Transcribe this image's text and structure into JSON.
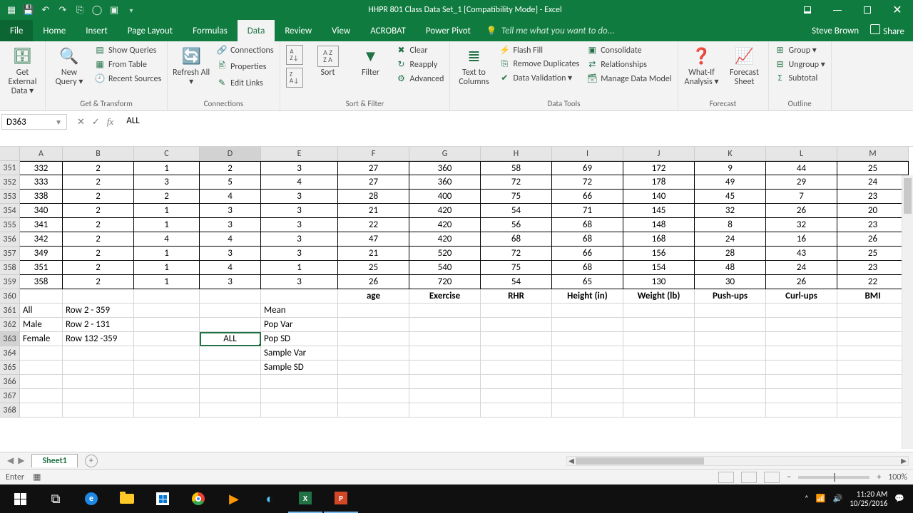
{
  "title": "HHPR 801 Class Data Set_1  [Compatibility Mode] - Excel",
  "user": "Steve Brown",
  "share": "Share",
  "tabs": {
    "file": "File",
    "home": "Home",
    "insert": "Insert",
    "pagelayout": "Page Layout",
    "formulas": "Formulas",
    "data": "Data",
    "review": "Review",
    "view": "View",
    "acrobat": "ACROBAT",
    "powerpivot": "Power Pivot",
    "tellme": "Tell me what you want to do..."
  },
  "ribbon": {
    "getdata": {
      "label": "Get External Data",
      "btn": "Get External Data ▾"
    },
    "gettransform": {
      "label": "Get & Transform",
      "newquery": "New Query ▾",
      "showqueries": "Show Queries",
      "fromtable": "From Table",
      "recent": "Recent Sources"
    },
    "connections": {
      "label": "Connections",
      "refresh": "Refresh All ▾",
      "conn": "Connections",
      "props": "Properties",
      "editlinks": "Edit Links"
    },
    "sortfilter": {
      "label": "Sort & Filter",
      "sort": "Sort",
      "filter": "Filter",
      "clear": "Clear",
      "reapply": "Reapply",
      "advanced": "Advanced"
    },
    "datatools": {
      "label": "Data Tools",
      "t2c": "Text to Columns",
      "flash": "Flash Fill",
      "dup": "Remove Duplicates",
      "valid": "Data Validation ▾",
      "consol": "Consolidate",
      "rel": "Relationships",
      "mdm": "Manage Data Model"
    },
    "forecast": {
      "label": "Forecast",
      "whatif": "What-If Analysis ▾",
      "fsheet": "Forecast Sheet"
    },
    "outline": {
      "label": "Outline",
      "group": "Group ▾",
      "ungroup": "Ungroup ▾",
      "subtotal": "Subtotal"
    }
  },
  "namebox": "D363",
  "formula": "ALL",
  "columns": [
    "A",
    "B",
    "C",
    "D",
    "E",
    "F",
    "G",
    "H",
    "I",
    "J",
    "K",
    "L",
    "M"
  ],
  "rowNums": [
    "351",
    "352",
    "353",
    "354",
    "355",
    "356",
    "357",
    "358",
    "359",
    "360",
    "361",
    "362",
    "363",
    "364",
    "365",
    "366",
    "367",
    "368"
  ],
  "dataRows": [
    [
      "332",
      "2",
      "1",
      "2",
      "3",
      "27",
      "360",
      "58",
      "69",
      "172",
      "9",
      "44",
      "25"
    ],
    [
      "333",
      "2",
      "3",
      "5",
      "4",
      "27",
      "360",
      "72",
      "72",
      "178",
      "49",
      "29",
      "24"
    ],
    [
      "338",
      "2",
      "2",
      "4",
      "3",
      "28",
      "400",
      "75",
      "66",
      "140",
      "45",
      "7",
      "23"
    ],
    [
      "340",
      "2",
      "1",
      "3",
      "3",
      "21",
      "420",
      "54",
      "71",
      "145",
      "32",
      "26",
      "20"
    ],
    [
      "341",
      "2",
      "1",
      "3",
      "3",
      "22",
      "420",
      "56",
      "68",
      "148",
      "8",
      "32",
      "23"
    ],
    [
      "342",
      "2",
      "4",
      "4",
      "3",
      "47",
      "420",
      "68",
      "68",
      "168",
      "24",
      "16",
      "26"
    ],
    [
      "349",
      "2",
      "1",
      "3",
      "3",
      "21",
      "520",
      "72",
      "66",
      "156",
      "28",
      "43",
      "25"
    ],
    [
      "351",
      "2",
      "1",
      "4",
      "1",
      "25",
      "540",
      "75",
      "68",
      "154",
      "48",
      "24",
      "23"
    ],
    [
      "358",
      "2",
      "1",
      "3",
      "3",
      "26",
      "720",
      "54",
      "65",
      "130",
      "30",
      "26",
      "22"
    ]
  ],
  "headerRow": [
    "",
    "",
    "",
    "",
    "",
    "age",
    "Exercise",
    "RHR",
    "Height (in)",
    "Weight (lb)",
    "Push-ups",
    "Curl-ups",
    "BMI"
  ],
  "labelRows": [
    [
      "All",
      "Row 2 - 359",
      "",
      "",
      "Mean",
      "",
      "",
      "",
      "",
      "",
      "",
      "",
      ""
    ],
    [
      "Male",
      "Row 2 - 131",
      "",
      "",
      "Pop Var",
      "",
      "",
      "",
      "",
      "",
      "",
      "",
      ""
    ],
    [
      "Female",
      "Row 132 -359",
      "",
      "ALL",
      "Pop SD",
      "",
      "",
      "",
      "",
      "",
      "",
      "",
      ""
    ],
    [
      "",
      "",
      "",
      "",
      "Sample Var",
      "",
      "",
      "",
      "",
      "",
      "",
      "",
      ""
    ],
    [
      "",
      "",
      "",
      "",
      "Sample SD",
      "",
      "",
      "",
      "",
      "",
      "",
      "",
      ""
    ]
  ],
  "selectedCell": "ALL",
  "sheet": "Sheet1",
  "status": "Enter",
  "zoom": "100%",
  "clock": {
    "time": "11:20 AM",
    "date": "10/25/2016"
  }
}
